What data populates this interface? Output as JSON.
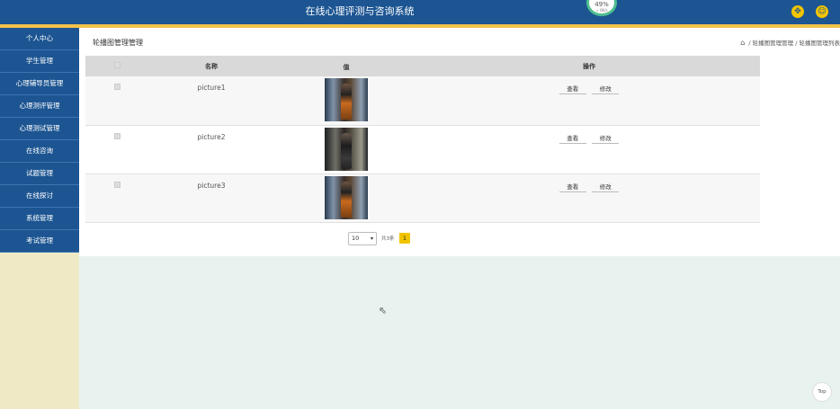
{
  "header": {
    "title": "在线心理评测与咨询系统",
    "gauge_value": "49%",
    "gauge_sub": "↓ 0K/s",
    "icons": [
      "expand-icon",
      "user-icon"
    ]
  },
  "sidebar": {
    "items": [
      "个人中心",
      "学生管理",
      "心理辅导员管理",
      "心理测评管理",
      "心理测试管理",
      "在线咨询",
      "试题管理",
      "在线探讨",
      "系统管理",
      "考试管理"
    ]
  },
  "content": {
    "page_title": "轮播图管理管理",
    "breadcrumb": [
      "轮播图管理管理",
      "轮播图管理列表"
    ],
    "table": {
      "headers": [
        "名称",
        "值",
        "操作"
      ],
      "rows": [
        {
          "name": "picture1",
          "image": "light"
        },
        {
          "name": "picture2",
          "image": "dark"
        },
        {
          "name": "picture3",
          "image": "light"
        }
      ],
      "actions": [
        "查看",
        "修改"
      ]
    },
    "pagination": {
      "page_size": "10",
      "total": "共3条",
      "current_page": "1"
    }
  },
  "misc": {
    "top_button": "Top"
  },
  "colors": {
    "header_bg": "#1c5592",
    "accent_yellow": "#f2c24b",
    "sidebar_bg": "#efe9c5",
    "page_bg": "#e8f3ef"
  }
}
